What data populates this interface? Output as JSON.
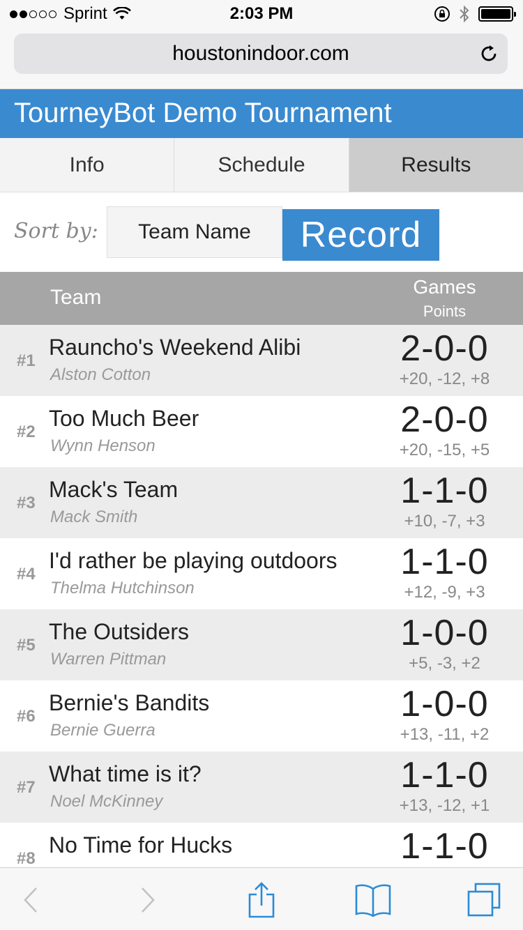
{
  "status_bar": {
    "carrier": "Sprint",
    "time": "2:03 PM",
    "signal_bars_filled": 2,
    "signal_bars_total": 5
  },
  "browser": {
    "url": "houstonindoor.com"
  },
  "header": {
    "title": "TourneyBot Demo Tournament"
  },
  "tabs": [
    {
      "label": "Info",
      "active": false
    },
    {
      "label": "Schedule",
      "active": false
    },
    {
      "label": "Results",
      "active": true
    }
  ],
  "sort": {
    "label": "Sort by:",
    "options": [
      {
        "label": "Team Name",
        "active": false
      },
      {
        "label": "Record",
        "active": true
      }
    ]
  },
  "table": {
    "header_team": "Team",
    "header_games": "Games",
    "header_points": "Points",
    "rows": [
      {
        "rank": "#1",
        "team": "Rauncho's Weekend Alibi",
        "captain": "Alston Cotton",
        "record": "2-0-0",
        "points": "+20, -12, +8"
      },
      {
        "rank": "#2",
        "team": "Too Much Beer",
        "captain": "Wynn Henson",
        "record": "2-0-0",
        "points": "+20, -15, +5"
      },
      {
        "rank": "#3",
        "team": "Mack's Team",
        "captain": "Mack Smith",
        "record": "1-1-0",
        "points": "+10, -7, +3"
      },
      {
        "rank": "#4",
        "team": "I'd rather be playing outdoors",
        "captain": "Thelma Hutchinson",
        "record": "1-1-0",
        "points": "+12, -9, +3"
      },
      {
        "rank": "#5",
        "team": "The Outsiders",
        "captain": "Warren Pittman",
        "record": "1-0-0",
        "points": "+5, -3, +2"
      },
      {
        "rank": "#6",
        "team": "Bernie's Bandits",
        "captain": "Bernie Guerra",
        "record": "1-0-0",
        "points": "+13, -11, +2"
      },
      {
        "rank": "#7",
        "team": "What time is it?",
        "captain": "Noel McKinney",
        "record": "1-1-0",
        "points": "+13, -12, +1"
      },
      {
        "rank": "#8",
        "team": "No Time for Hucks",
        "captain": "",
        "record": "1-1-0",
        "points": ""
      }
    ]
  },
  "colors": {
    "brand_blue": "#3a8ad0",
    "header_gray": "#a6a6a6",
    "ios_blue": "#2b8bd6"
  }
}
